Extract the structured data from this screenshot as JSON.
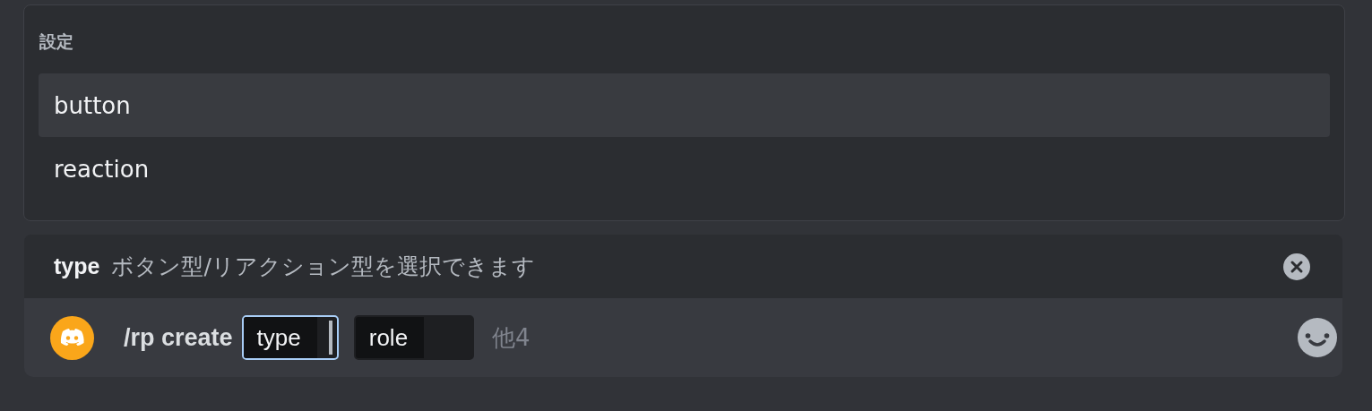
{
  "autocomplete": {
    "title": "設定",
    "options": [
      {
        "label": "button",
        "selected": true
      },
      {
        "label": "reaction",
        "selected": false
      }
    ]
  },
  "option_hint": {
    "name": "type",
    "description": "ボタン型/リアクション型を選択できます"
  },
  "command_bar": {
    "command": "/rp create",
    "options": [
      {
        "name": "type",
        "selected": true
      },
      {
        "name": "role",
        "selected": false
      }
    ],
    "more": "他4"
  }
}
